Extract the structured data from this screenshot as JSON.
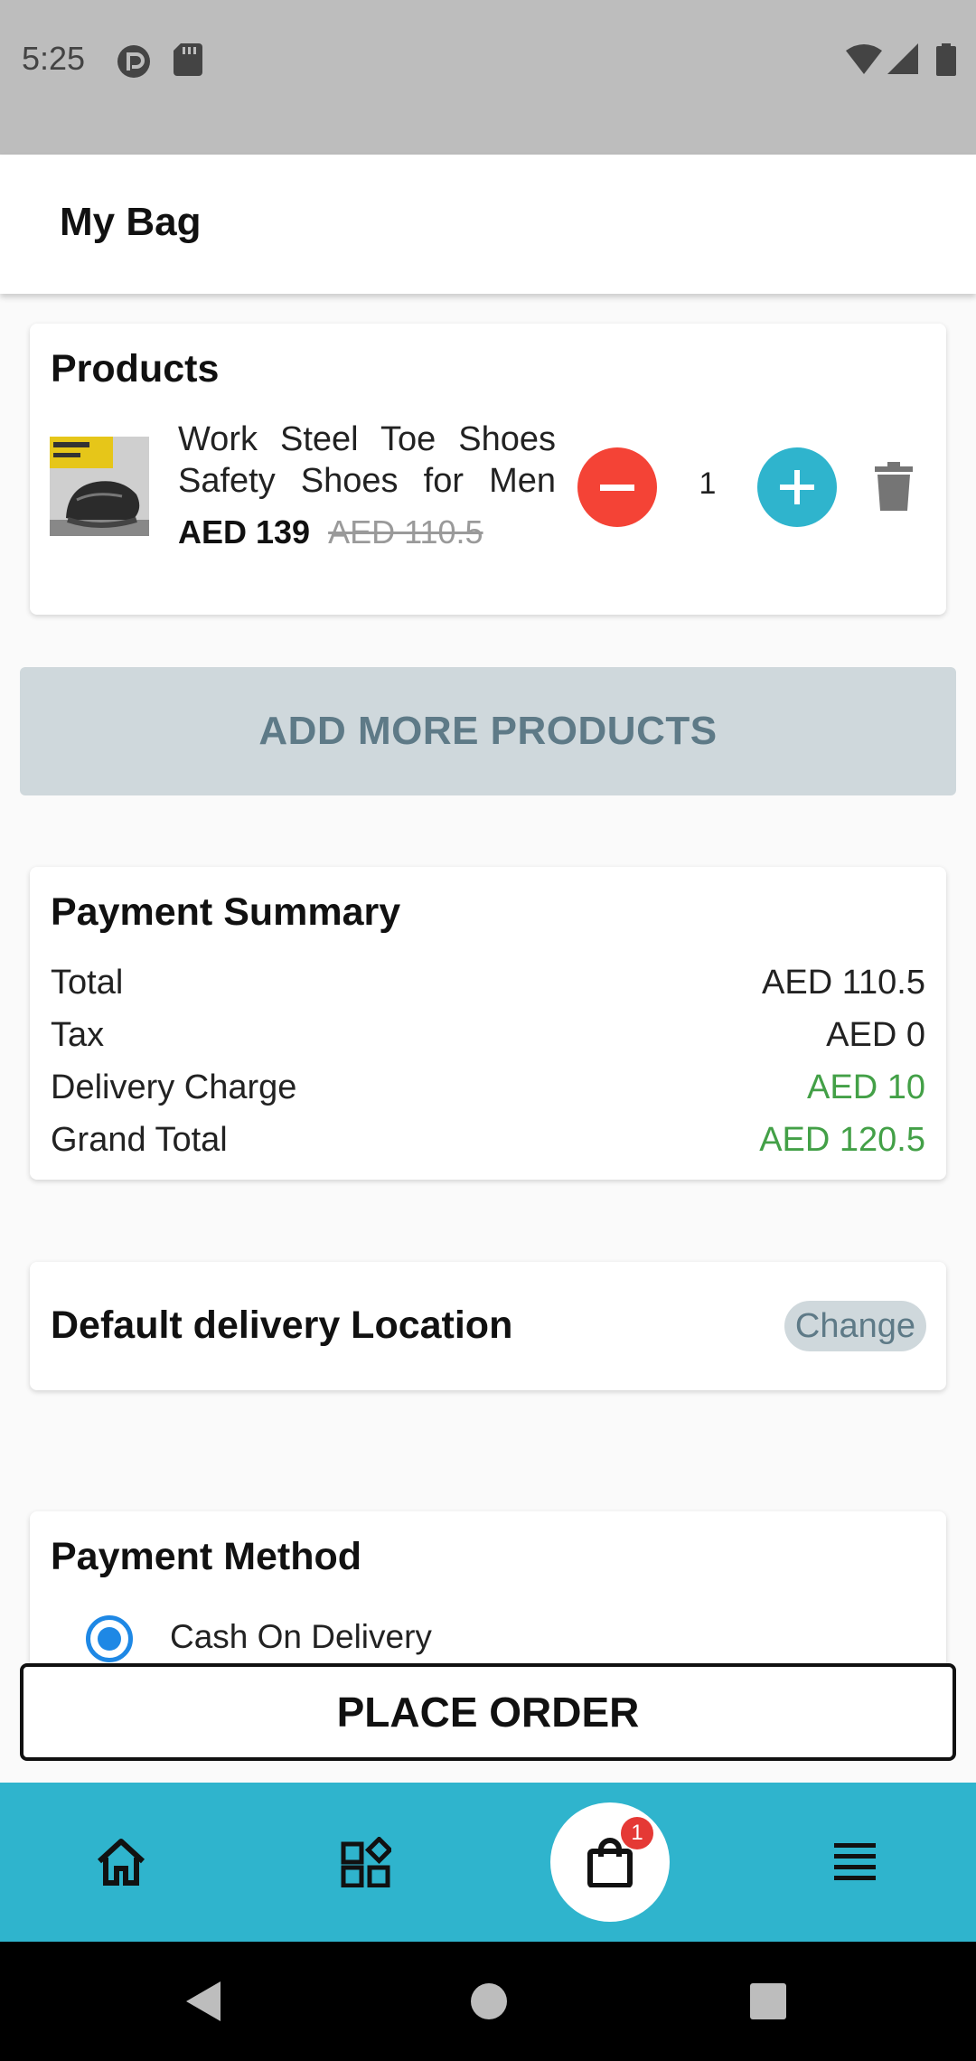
{
  "status_bar": {
    "time": "5:25"
  },
  "app_bar": {
    "title": "My Bag"
  },
  "products": {
    "title": "Products",
    "items": [
      {
        "name": "Work Steel Toe Shoes Safety Shoes for Men",
        "price": "AED 139",
        "original_price": "AED 110.5",
        "quantity": "1"
      }
    ]
  },
  "add_more_label": "ADD MORE PRODUCTS",
  "payment_summary": {
    "title": "Payment Summary",
    "rows": [
      {
        "label": "Total",
        "value": "AED 110.5"
      },
      {
        "label": "Tax",
        "value": "AED 0"
      },
      {
        "label": "Delivery Charge",
        "value": "AED 10"
      },
      {
        "label": "Grand Total",
        "value": "AED 120.5"
      }
    ]
  },
  "delivery_location": {
    "title": "Default delivery Location",
    "change_label": "Change"
  },
  "payment_method": {
    "title": "Payment Method",
    "options": [
      {
        "label": "Cash On Delivery",
        "selected": true
      }
    ]
  },
  "place_order_label": "PLACE ORDER",
  "bottom_nav": {
    "items": [
      "home-icon",
      "categories-icon",
      "shopping-bag-icon",
      "menu-icon"
    ],
    "cart_badge": "1"
  },
  "colors": {
    "accent": "#2fb4cd",
    "minus": "#f44336",
    "green": "#43a047",
    "radio": "#1e88e5",
    "badge": "#e53935"
  }
}
